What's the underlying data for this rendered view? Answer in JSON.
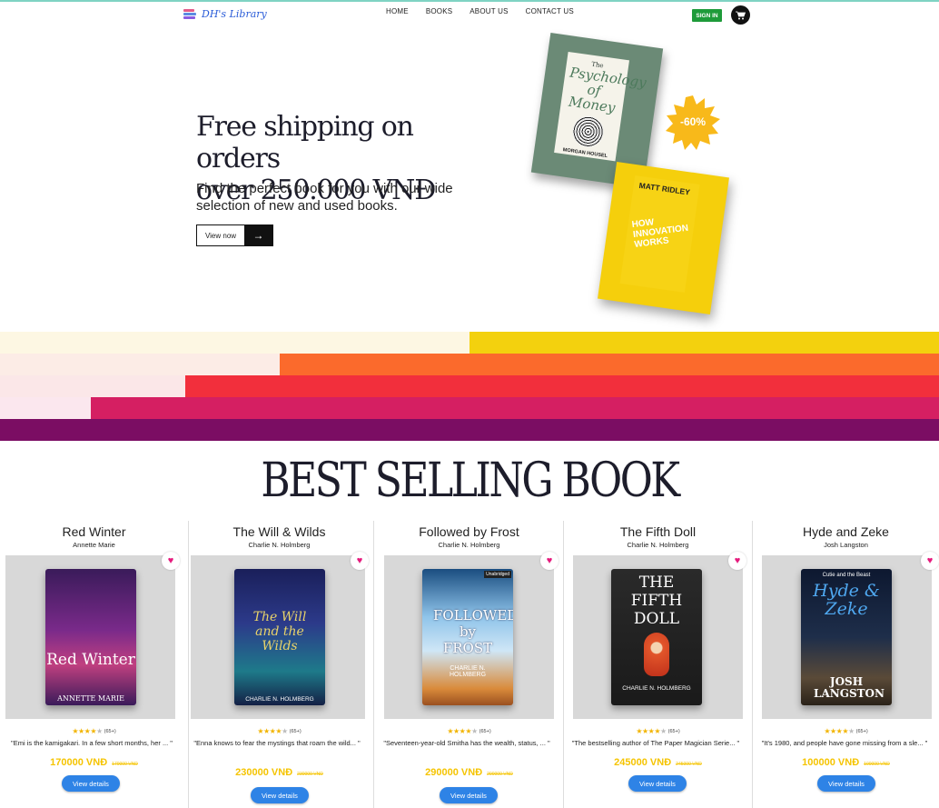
{
  "app": {
    "logo_text": "DH's Library"
  },
  "nav": {
    "links": [
      "HOME",
      "BOOKS",
      "ABOUT US",
      "CONTACT US"
    ],
    "signin_label": "SIGN IN",
    "cart_icon": "cart-icon"
  },
  "hero": {
    "title_line1": "Free shipping on orders",
    "title_line2": "over 250.000 VNĐ",
    "subtitle": "Find the perfect book for you with our wide selection of new and used books.",
    "cta_label": "View now",
    "cta_icon": "arrow-right-icon",
    "discount_badge": "-60%",
    "featured_books": [
      {
        "title_top": "The",
        "title_main": "Psychology of Money",
        "author": "MORGAN HOUSEL"
      },
      {
        "author": "MATT RIDLEY",
        "title_main": "HOW INNOVATION WORKS"
      }
    ]
  },
  "stripes": {
    "colors": [
      "#f3d10e",
      "#fb6a2c",
      "#f22f3c",
      "#d51f62",
      "#7b0d63"
    ]
  },
  "section": {
    "title": "BEST SELLING BOOK"
  },
  "books": [
    {
      "title": "Red Winter",
      "author": "Annette Marie",
      "rating_count": "(65+)",
      "description": "\"Emi is the kamigakari. In a few short months, her ... \"",
      "price": "170000 VNĐ",
      "old_price": "170000 VNĐ",
      "button_label": "View details",
      "cover_title": "Red Winter",
      "cover_author": "ANNETTE MARIE",
      "favorite_icon": "heart-icon"
    },
    {
      "title": "The Will & Wilds",
      "author": "Charlie N. Holmberg",
      "rating_count": "(65+)",
      "description": "\"Enna knows to fear the mystings that roam the wild... \"",
      "price": "230000 VNĐ",
      "old_price": "230000 VNĐ",
      "button_label": "View details",
      "cover_title": "The Will and the Wilds",
      "cover_author": "CHARLIE N. HOLMBERG",
      "favorite_icon": "heart-icon"
    },
    {
      "title": "Followed by Frost",
      "author": "Charlie N. Holmberg",
      "rating_count": "(65+)",
      "description": "\"Seventeen-year-old Smitha has the wealth, status, ... \"",
      "price": "290000 VNĐ",
      "old_price": "290000 VNĐ",
      "button_label": "View details",
      "cover_title": "FOLLOWED by FROST",
      "cover_author": "CHARLIE N. HOLMBERG",
      "cover_badge": "Unabridged",
      "favorite_icon": "heart-icon"
    },
    {
      "title": "The Fifth Doll",
      "author": "Charlie N. Holmberg",
      "rating_count": "(65+)",
      "description": "\"The bestselling author of The Paper Magician Serie... \"",
      "price": "245000 VNĐ",
      "old_price": "245000 VNĐ",
      "button_label": "View details",
      "cover_title": "THE FIFTH DOLL",
      "cover_author": "CHARLIE N. HOLMBERG",
      "favorite_icon": "heart-icon"
    },
    {
      "title": "Hyde and Zeke",
      "author": "Josh Langston",
      "rating_count": "(65+)",
      "description": "\"It's 1980, and people have gone missing from a sle... \"",
      "price": "100000 VNĐ",
      "old_price": "100000 VNĐ",
      "button_label": "View details",
      "cover_title": "Hyde & Zeke",
      "cover_subtitle": "Cutie and the Beast",
      "cover_author": "JOSH LANGSTON",
      "favorite_icon": "heart-icon"
    }
  ]
}
